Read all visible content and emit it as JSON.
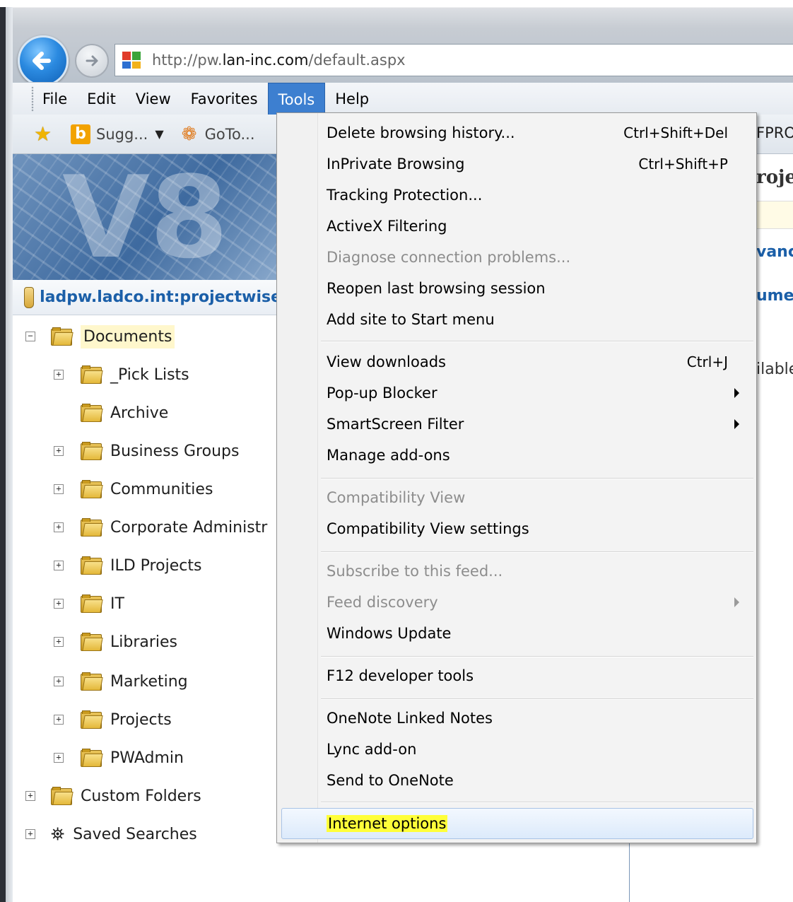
{
  "browser": {
    "url_prefix": "http://pw.",
    "url_domain": "lan-inc.com",
    "url_suffix": "/default.aspx"
  },
  "menubar": {
    "items": [
      {
        "label": "File"
      },
      {
        "label": "Edit"
      },
      {
        "label": "View"
      },
      {
        "label": "Favorites"
      },
      {
        "label": "Tools",
        "active": true
      },
      {
        "label": "Help"
      }
    ]
  },
  "favorites_bar": {
    "items": [
      {
        "label": "Sugg...",
        "icon": "bing-icon",
        "dropdown": "▼"
      },
      {
        "label": "GoTo...",
        "icon": "goto-icon"
      }
    ]
  },
  "page": {
    "banner_text": "V8",
    "datasource": "ladpw.ladco.int:projectwise",
    "tree": [
      {
        "label": "Documents",
        "level": 0,
        "expander": "⊟",
        "selected": true
      },
      {
        "label": "_Pick Lists",
        "level": 1,
        "expander": "+"
      },
      {
        "label": "Archive",
        "level": 1,
        "expander": ""
      },
      {
        "label": "Business Groups",
        "level": 1,
        "expander": "+"
      },
      {
        "label": "Communities",
        "level": 1,
        "expander": "+"
      },
      {
        "label": "Corporate Administr",
        "level": 1,
        "expander": "+"
      },
      {
        "label": "ILD Projects",
        "level": 1,
        "expander": "+"
      },
      {
        "label": "IT",
        "level": 1,
        "expander": "+"
      },
      {
        "label": "Libraries",
        "level": 1,
        "expander": "+"
      },
      {
        "label": "Marketing",
        "level": 1,
        "expander": "+"
      },
      {
        "label": "Projects",
        "level": 1,
        "expander": "+"
      },
      {
        "label": "PWAdmin",
        "level": 1,
        "expander": "+"
      },
      {
        "label": "Custom Folders",
        "level": 0,
        "expander": "+"
      },
      {
        "label": "Saved Searches",
        "level": 0,
        "expander": "+"
      }
    ],
    "right_fragments": {
      "fpro": "FPRO",
      "proje": "roje",
      "vanc": "vanc",
      "umen": "umer",
      "ilable": "ilable"
    }
  },
  "tools_menu": {
    "items": [
      {
        "label": "Delete browsing history...",
        "shortcut": "Ctrl+Shift+Del"
      },
      {
        "label": "InPrivate Browsing",
        "shortcut": "Ctrl+Shift+P"
      },
      {
        "label": "Tracking Protection..."
      },
      {
        "label": "ActiveX Filtering"
      },
      {
        "label": "Diagnose connection problems...",
        "disabled": true
      },
      {
        "label": "Reopen last browsing session"
      },
      {
        "label": "Add site to Start menu"
      },
      {
        "label": "View downloads",
        "shortcut": "Ctrl+J"
      },
      {
        "label": "Pop-up Blocker",
        "submenu": true
      },
      {
        "label": "SmartScreen Filter",
        "submenu": true
      },
      {
        "label": "Manage add-ons"
      },
      {
        "label": "Compatibility View",
        "disabled": true
      },
      {
        "label": "Compatibility View settings"
      },
      {
        "label": "Subscribe to this feed...",
        "disabled": true
      },
      {
        "label": "Feed discovery",
        "disabled": true,
        "submenu": true
      },
      {
        "label": "Windows Update"
      },
      {
        "label": "F12 developer tools"
      },
      {
        "label": "OneNote Linked Notes"
      },
      {
        "label": "Lync add-on"
      },
      {
        "label": "Send to OneNote"
      },
      {
        "label": "Internet options",
        "highlighted": true
      }
    ]
  },
  "colors": {
    "menu_active": "#3d7fd0",
    "highlight": "#ffff3a",
    "link_blue": "#1b5fa8"
  }
}
